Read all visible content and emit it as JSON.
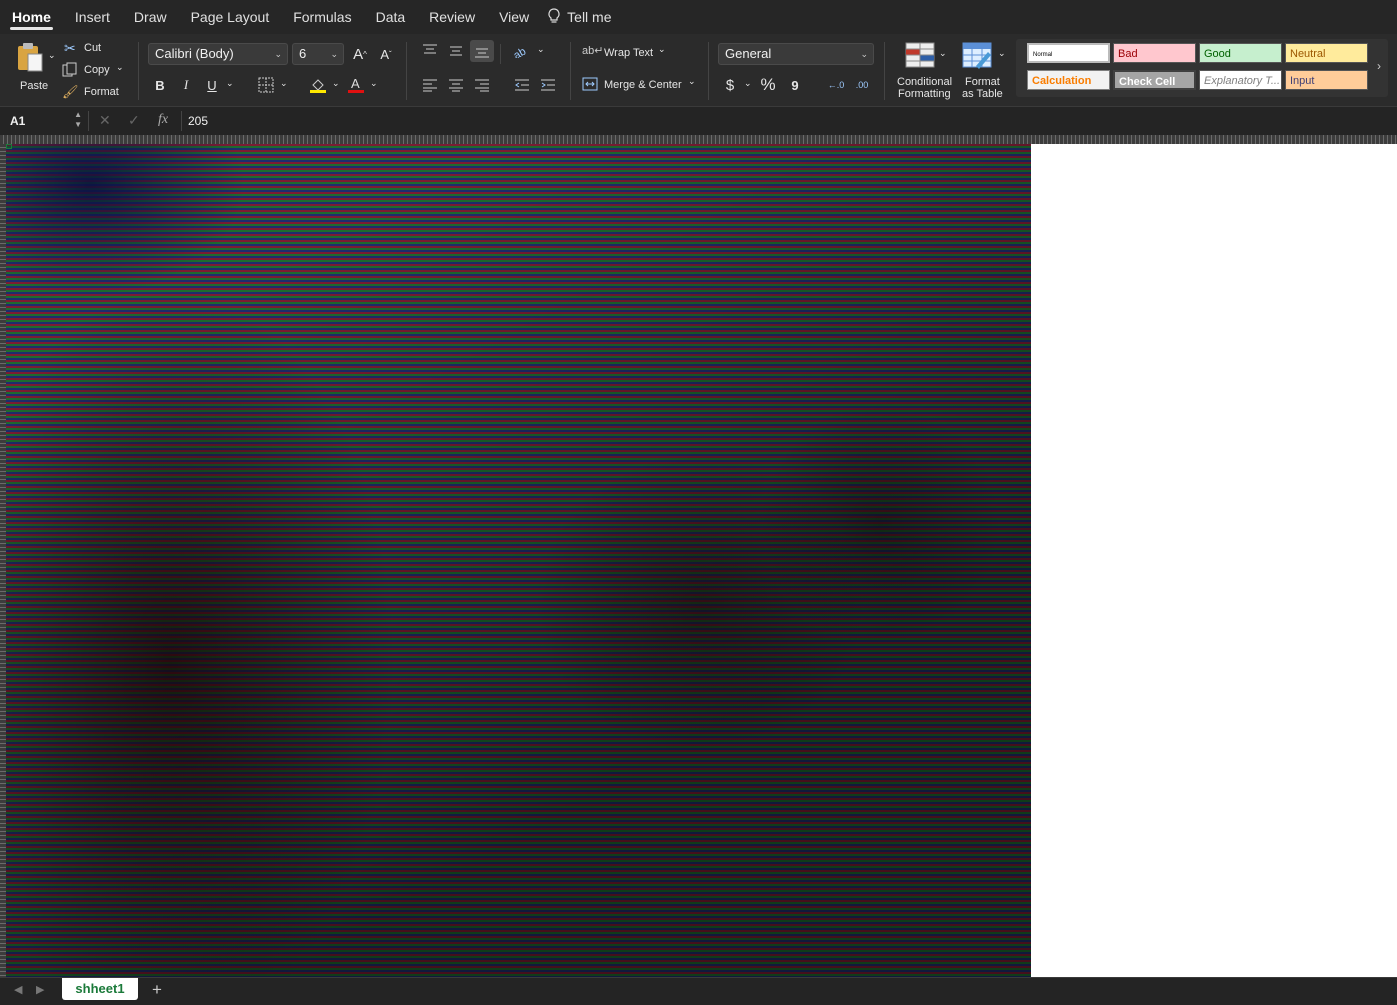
{
  "menu": {
    "tabs": [
      "Home",
      "Insert",
      "Draw",
      "Page Layout",
      "Formulas",
      "Data",
      "Review",
      "View"
    ],
    "active_tab": "Home",
    "tell_me": "Tell me"
  },
  "clipboard": {
    "paste": "Paste",
    "cut": "Cut",
    "copy": "Copy",
    "format": "Format"
  },
  "font": {
    "name": "Calibri (Body)",
    "size": "6",
    "bold": "B",
    "italic": "I",
    "underline": "U"
  },
  "alignment": {
    "wrap_text": "Wrap Text",
    "merge_center": "Merge & Center"
  },
  "number": {
    "format": "General",
    "currency": "$",
    "percent": "%",
    "comma": "9"
  },
  "styles": {
    "conditional_formatting": [
      "Conditional",
      "Formatting"
    ],
    "format_as_table": [
      "Format",
      "as Table"
    ],
    "cells": [
      {
        "label": "Normal",
        "bg": "#ffffff",
        "fg": "#000000"
      },
      {
        "label": "Bad",
        "bg": "#ffc7ce",
        "fg": "#9c0006"
      },
      {
        "label": "Good",
        "bg": "#c6efce",
        "fg": "#006100"
      },
      {
        "label": "Neutral",
        "bg": "#ffeb9c",
        "fg": "#9c5700"
      },
      {
        "label": "Calculation",
        "bg": "#f2f2f2",
        "fg": "#fa7d00"
      },
      {
        "label": "Check Cell",
        "bg": "#a5a5a5",
        "fg": "#ffffff"
      },
      {
        "label": "Explanatory T...",
        "bg": "#ffffff",
        "fg": "#7f7f7f"
      },
      {
        "label": "Input",
        "bg": "#ffcc99",
        "fg": "#3f3f76"
      }
    ]
  },
  "formula_bar": {
    "cell_ref": "A1",
    "fx": "fx",
    "value": "205"
  },
  "sheets": {
    "active": "shheet1",
    "add": "+"
  },
  "colors": {
    "ribbon_bg": "#2b2b2b",
    "sheet_tab_text": "#1b7a3a"
  }
}
